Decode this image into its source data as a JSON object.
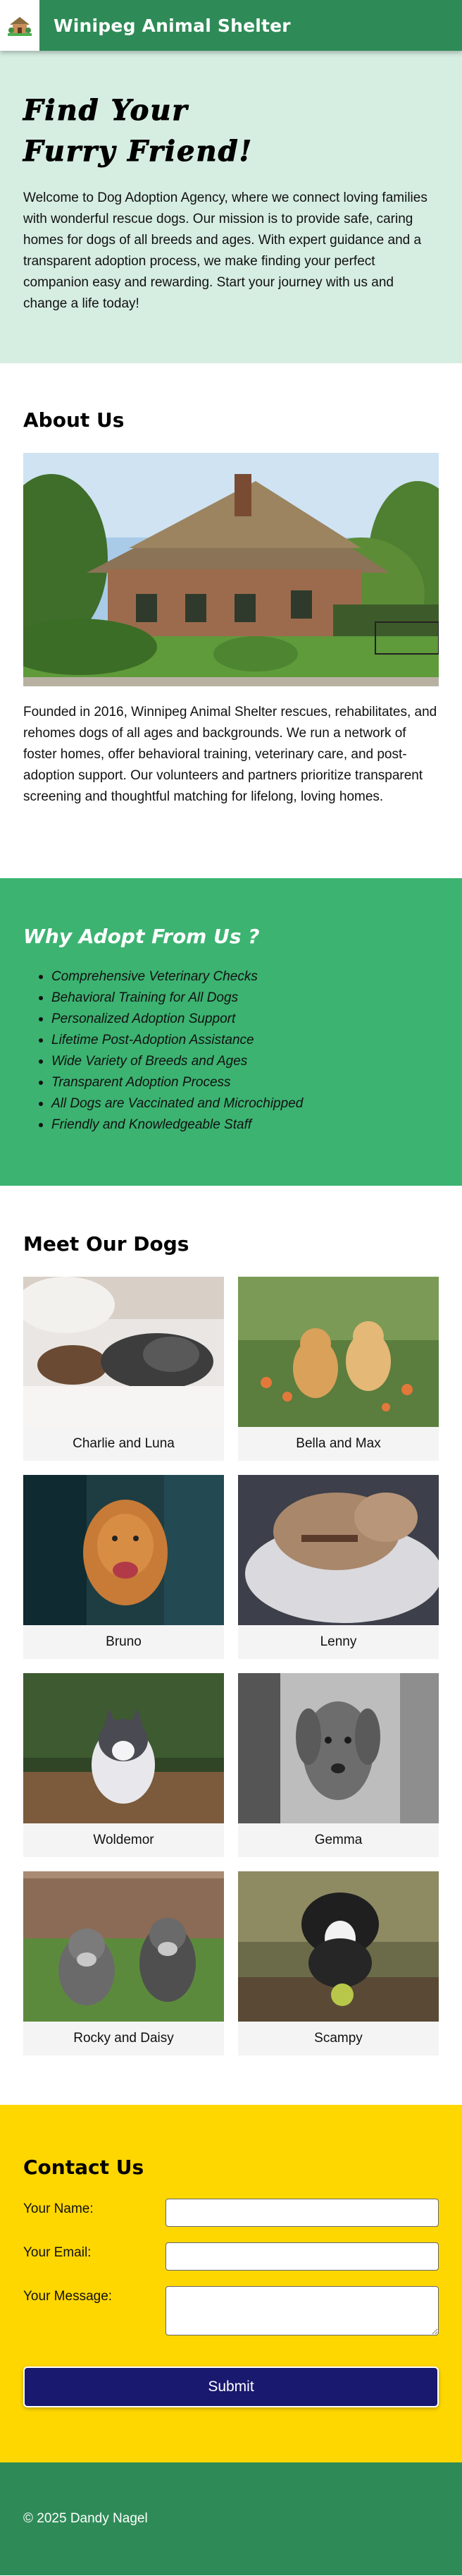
{
  "header": {
    "title": "Winipeg Animal Shelter",
    "logo_icon": "house-icon",
    "bg_color": "#2e8b57"
  },
  "hero": {
    "title_line1": "Find Your",
    "title_line2": "Furry Friend!",
    "text": "Welcome to Dog Adoption Agency, where we connect loving families with wonderful rescue dogs. Our mission is to provide safe, caring homes for dogs of all breeds and ages. With expert guidance and a transparent adoption process, we make finding your perfect companion easy and rewarding. Start your journey with us and change a life today!",
    "bg_color": "#d6ede2"
  },
  "about": {
    "title": "About Us",
    "text": "Founded in 2016, Winnipeg Animal Shelter rescues, rehabilitates, and rehomes dogs of all ages and backgrounds. We run a network of foster homes, offer behavioral training, veterinary care, and post-adoption support. Our volunteers and partners prioritize transparent screening and thoughtful matching for lifelong, loving homes."
  },
  "why": {
    "title": "Why Adopt From Us ?",
    "bg_color": "#3cb371",
    "items": [
      "Comprehensive Veterinary Checks",
      "Behavioral Training for All Dogs",
      "Personalized Adoption Support",
      "Lifetime Post-Adoption Assistance",
      "Wide Variety of Breeds and Ages",
      "Transparent Adoption Process",
      "All Dogs are Vaccinated and Microchipped",
      "Friendly and Knowledgeable Staff"
    ]
  },
  "dogs": {
    "title": "Meet Our Dogs",
    "items": [
      {
        "name": "Charlie and Luna"
      },
      {
        "name": "Bella and Max"
      },
      {
        "name": "Bruno"
      },
      {
        "name": "Lenny"
      },
      {
        "name": "Woldemor"
      },
      {
        "name": "Gemma"
      },
      {
        "name": "Rocky and Daisy"
      },
      {
        "name": "Scampy"
      }
    ]
  },
  "contact": {
    "title": "Contact Us",
    "name_label": "Your Name:",
    "email_label": "Your Email:",
    "message_label": "Your Message:",
    "name_value": "",
    "email_value": "",
    "message_value": "",
    "submit_label": "Submit",
    "bg_color": "#ffd700",
    "button_color": "#191970"
  },
  "footer": {
    "text": "© 2025 Dandy Nagel"
  }
}
